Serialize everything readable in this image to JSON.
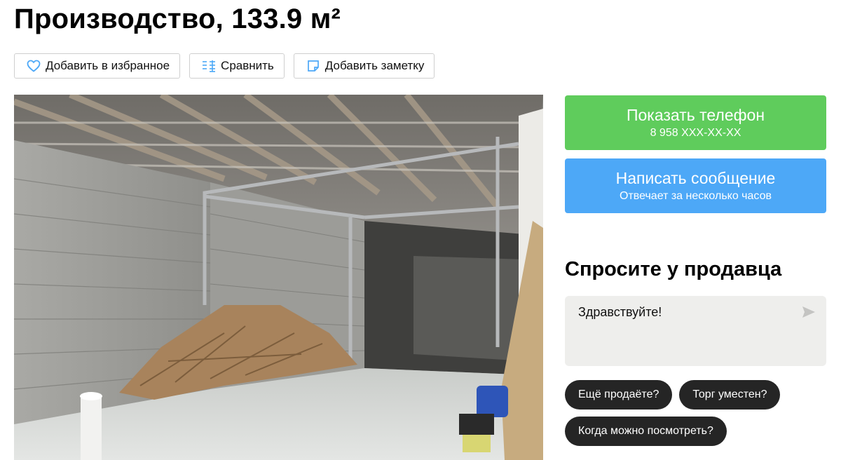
{
  "listing": {
    "title": "Производство, 133.9 м²"
  },
  "actions": [
    {
      "label": "Добавить в избранное",
      "icon": "heart-icon"
    },
    {
      "label": "Сравнить",
      "icon": "compare-icon"
    },
    {
      "label": "Добавить заметку",
      "icon": "note-icon"
    }
  ],
  "contact": {
    "phone_label": "Показать телефон",
    "phone_masked": "8 958 XXX-XX-XX",
    "message_label": "Написать сообщение",
    "message_sub": "Отвечает за несколько часов"
  },
  "ask": {
    "title": "Спросите у продавца",
    "message_value": "Здравствуйте!",
    "chips": [
      "Ещё продаёте?",
      "Торг уместен?",
      "Когда можно посмотреть?"
    ]
  },
  "colors": {
    "phone_button": "#5fcc5c",
    "message_button": "#4da8f7",
    "chip": "#252525",
    "accent_icon": "#4da8f7"
  }
}
